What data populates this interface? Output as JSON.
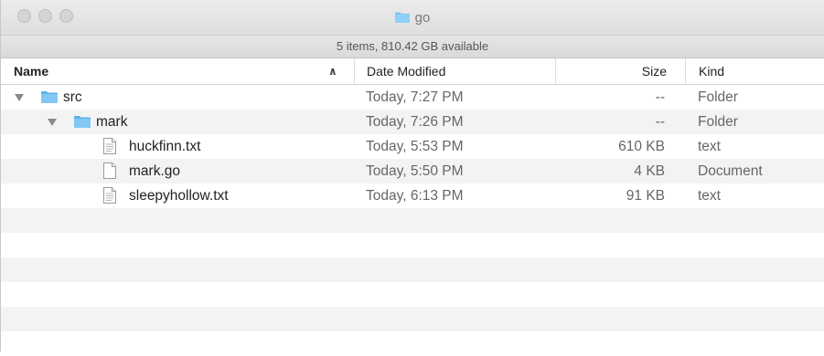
{
  "window": {
    "title": "go",
    "status": "5 items, 810.42 GB available"
  },
  "columns": {
    "name": "Name",
    "date": "Date Modified",
    "size": "Size",
    "kind": "Kind"
  },
  "rows": [
    {
      "name": "src",
      "date": "Today, 7:27 PM",
      "size": "--",
      "kind": "Folder",
      "icon": "folder-icon",
      "level": 0,
      "expanded": true
    },
    {
      "name": "mark",
      "date": "Today, 7:26 PM",
      "size": "--",
      "kind": "Folder",
      "icon": "folder-icon",
      "level": 1,
      "expanded": true
    },
    {
      "name": "huckfinn.txt",
      "date": "Today, 5:53 PM",
      "size": "610 KB",
      "kind": "text",
      "icon": "text-file-icon",
      "level": 2
    },
    {
      "name": "mark.go",
      "date": "Today, 5:50 PM",
      "size": "4 KB",
      "kind": "Document",
      "icon": "document-icon",
      "level": 2
    },
    {
      "name": "sleepyhollow.txt",
      "date": "Today, 6:13 PM",
      "size": "91 KB",
      "kind": "text",
      "icon": "text-file-icon",
      "level": 2
    }
  ],
  "colors": {
    "folder": "#7fc7f3",
    "folder_tab": "#5fb3ea",
    "stripe": "#f3f3f3"
  }
}
